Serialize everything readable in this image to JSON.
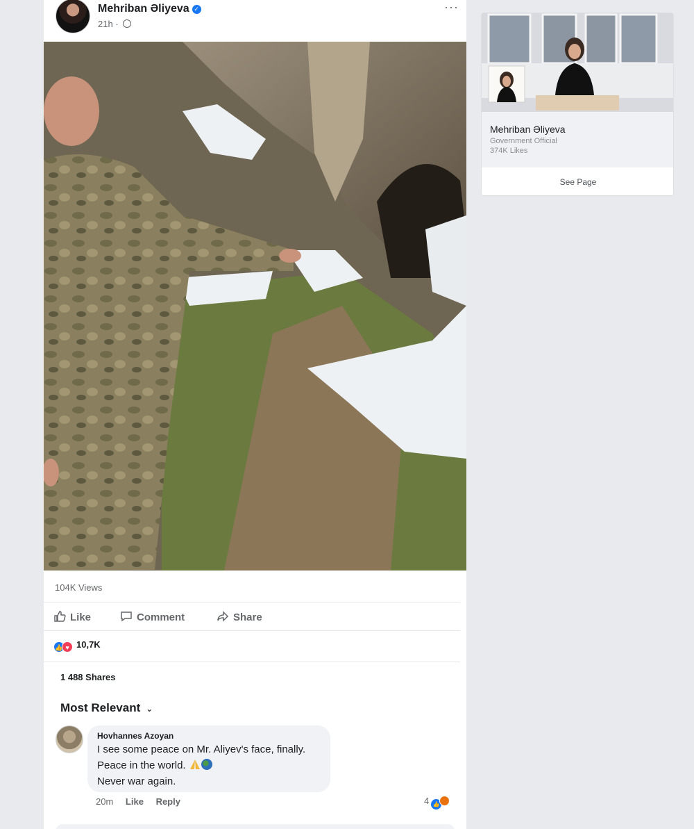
{
  "post": {
    "author": "Mehriban Əliyeva",
    "time": "21h ·",
    "more_label": "···",
    "views": "104K Views",
    "actions": {
      "like": "Like",
      "comment": "Comment",
      "share": "Share"
    },
    "reactions_count": "10,7K",
    "shares": "1 488 Shares",
    "sort_label": "Most Relevant",
    "comment": {
      "author": "Hovhannes  Azoyan",
      "line1": "I see some peace on Mr. Aliyev's face, finally.",
      "line2": "Peace in the world.",
      "line3": "Never war again.",
      "time": "20m",
      "like": "Like",
      "reply": "Reply",
      "reactions_count": "4"
    }
  },
  "page_card": {
    "name": "Mehriban Əliyeva",
    "category": "Government Official",
    "likes": "374K Likes",
    "button": "See Page"
  },
  "colors": {
    "brand_blue": "#1877f2",
    "love_red": "#f33e58",
    "bg": "#e9eaee"
  },
  "icons": [
    "verified-badge-icon",
    "globe-icon",
    "more-options-icon",
    "like-icon",
    "comment-icon",
    "share-icon",
    "chevron-down-icon",
    "folded-hands-emoji",
    "earth-globe-emoji"
  ]
}
